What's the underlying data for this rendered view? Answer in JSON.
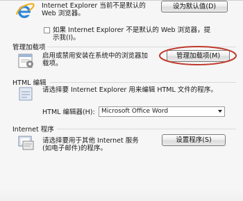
{
  "default_browser": {
    "text_line1": "Internet Explorer 当前不是默认的",
    "text_line2": "Web 浏览器。",
    "set_default_label": "设为默认值(D)",
    "notify_line1": "如果 Internet Explorer 不是默认的 Web 浏览器，提",
    "notify_line2": "示我(I)。"
  },
  "addons": {
    "title": "管理加载项",
    "desc_line1": "启用或禁用安装在系统中的浏览器加",
    "desc_line2": "载项。",
    "button_label": "管理加载项(M)"
  },
  "html_editing": {
    "title": "HTML 编辑",
    "desc": "请选择要 Internet Explorer 用来编辑 HTML 文件的程序。",
    "editor_label": "HTML 编辑器(H):",
    "editor_value": "Microsoft Office Word"
  },
  "internet_programs": {
    "title": "Internet 程序",
    "desc_line1": "请选择要用于其他 Internet 服务",
    "desc_line2": "(如电子邮件)的程序。",
    "button_label": "设置程序(S)"
  },
  "colors": {
    "highlight_circle": "#c0392b",
    "ie_blue": "#1f73c9",
    "ie_ring": "#f2b01e"
  }
}
